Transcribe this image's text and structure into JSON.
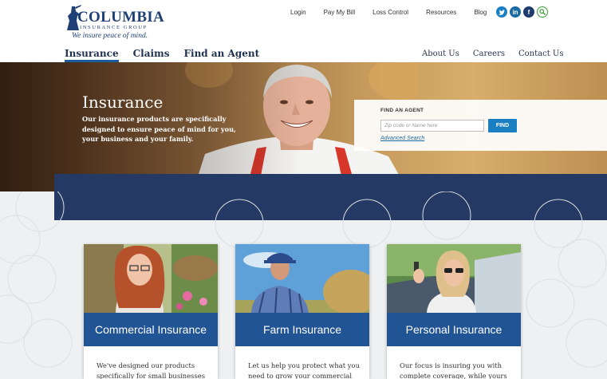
{
  "logo": {
    "name": "COLUMBIA",
    "group": "INSURANCE GROUP",
    "tagline": "We insure peace of mind."
  },
  "util_nav": [
    "Login",
    "Pay My Bill",
    "Loss Control",
    "Resources",
    "Blog"
  ],
  "socials": [
    {
      "icon": "twitter-icon",
      "glyph": "t"
    },
    {
      "icon": "linkedin-icon",
      "glyph": "in"
    },
    {
      "icon": "facebook-icon",
      "glyph": "f"
    },
    {
      "icon": "search-icon",
      "glyph": ""
    }
  ],
  "main_nav": [
    "Insurance",
    "Claims",
    "Find an Agent"
  ],
  "sec_nav": [
    "About Us",
    "Careers",
    "Contact Us"
  ],
  "hero": {
    "title": "Insurance",
    "text": "Our insurance products are specifically designed to ensure peace of mind for you, your business and your family."
  },
  "agent": {
    "label": "FIND AN AGENT",
    "placeholder": "Zip code or Name here",
    "button": "FIND",
    "advanced": "Advanced Search"
  },
  "cards": [
    {
      "title": "Commercial Insurance",
      "text": "We've designed our products specifically for small businesses like"
    },
    {
      "title": "Farm Insurance",
      "text": "Let us help you protect what you need to grow your commercial or"
    },
    {
      "title": "Personal Insurance",
      "text": "Our focus is insuring you with complete coverage, while yours is on"
    }
  ],
  "colors": {
    "brand_navy": "#1f3f77",
    "card_blue": "#215495",
    "button_blue": "#1a7ec2",
    "band_navy": "#243963"
  }
}
